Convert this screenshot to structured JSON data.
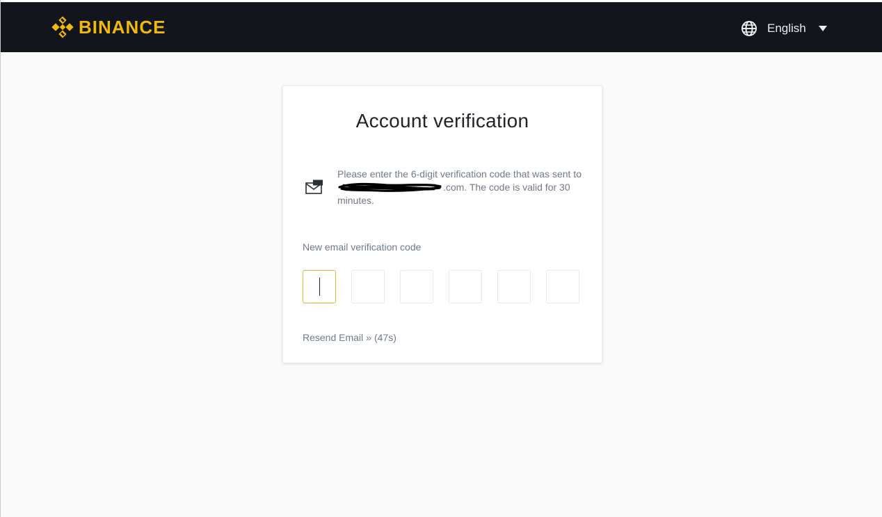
{
  "header": {
    "brand": "BINANCE",
    "language": "English"
  },
  "card": {
    "title": "Account verification",
    "notice_before": "Please enter the 6-digit verification code that was sent to",
    "notice_after": ".com. The code is valid for 30 minutes.",
    "field_label": "New email verification code",
    "code_digits": [
      "",
      "",
      "",
      "",
      "",
      ""
    ],
    "resend_label": "Resend Email",
    "resend_chevron": "»",
    "countdown": "(47s)"
  },
  "colors": {
    "brand": "#f0b90b",
    "header_bg": "#12161c",
    "active_border": "#e0b52f",
    "muted_text": "#707a8a"
  }
}
